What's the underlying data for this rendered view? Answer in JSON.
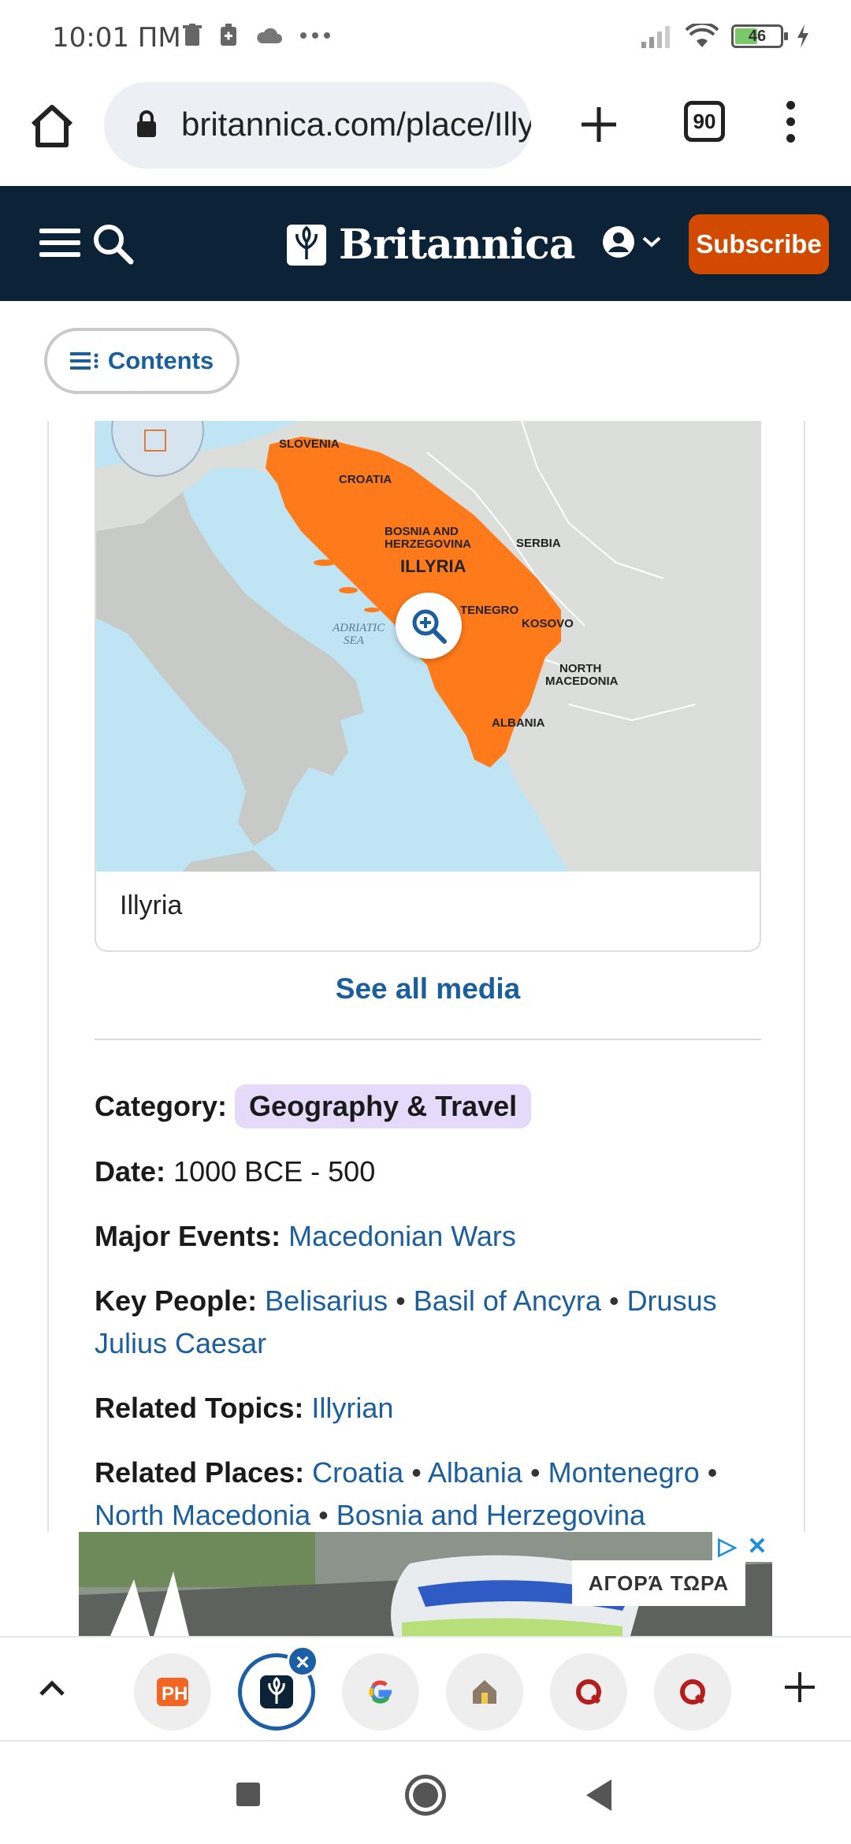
{
  "status_bar": {
    "time": "10:01 ПМ",
    "battery_level": "46"
  },
  "browser": {
    "url": "britannica.com/place/Illyria",
    "tab_count": "90"
  },
  "site_header": {
    "brand": "Britannica",
    "subscribe_label": "Subscribe"
  },
  "contents_label": "Contents",
  "media": {
    "map_labels": {
      "slovenia": "SLOVENIA",
      "croatia": "CROATIA",
      "bosnia_1": "BOSNIA AND",
      "bosnia_2": "HERZEGOVINA",
      "illyria": "ILLYRIA",
      "serbia": "SERBIA",
      "montenegro": "TENEGRO",
      "kosovo": "KOSOVO",
      "adriatic_1": "ADRIATIC",
      "adriatic_2": "SEA",
      "north_macedonia_1": "NORTH",
      "north_macedonia_2": "MACEDONIA",
      "albania": "ALBANIA"
    },
    "caption": "Illyria",
    "see_all_label": "See all media"
  },
  "facts": {
    "category_label": "Category:",
    "category_value": "Geography & Travel",
    "date_label": "Date:",
    "date_value": "1000 BCE - 500",
    "major_events_label": "Major Events:",
    "major_events": [
      "Macedonian Wars"
    ],
    "key_people_label": "Key People:",
    "key_people": [
      "Belisarius",
      "Basil of Ancyra",
      "Drusus Julius Caesar"
    ],
    "related_topics_label": "Related Topics:",
    "related_topics": [
      "Illyrian"
    ],
    "related_places_label": "Related Places:",
    "related_places": [
      "Croatia",
      "Albania",
      "Montenegro",
      "North Macedonia",
      "Bosnia and Herzegovina"
    ]
  },
  "ad": {
    "cta": "ΑΓΟΡΆ ΤΩΡΑ"
  },
  "colors": {
    "header_bg": "#0c2236",
    "subscribe_bg": "#d24a00",
    "link": "#1b5e9e",
    "map_highlight": "#ff7a1a",
    "category_badge": "#e6dafb"
  }
}
